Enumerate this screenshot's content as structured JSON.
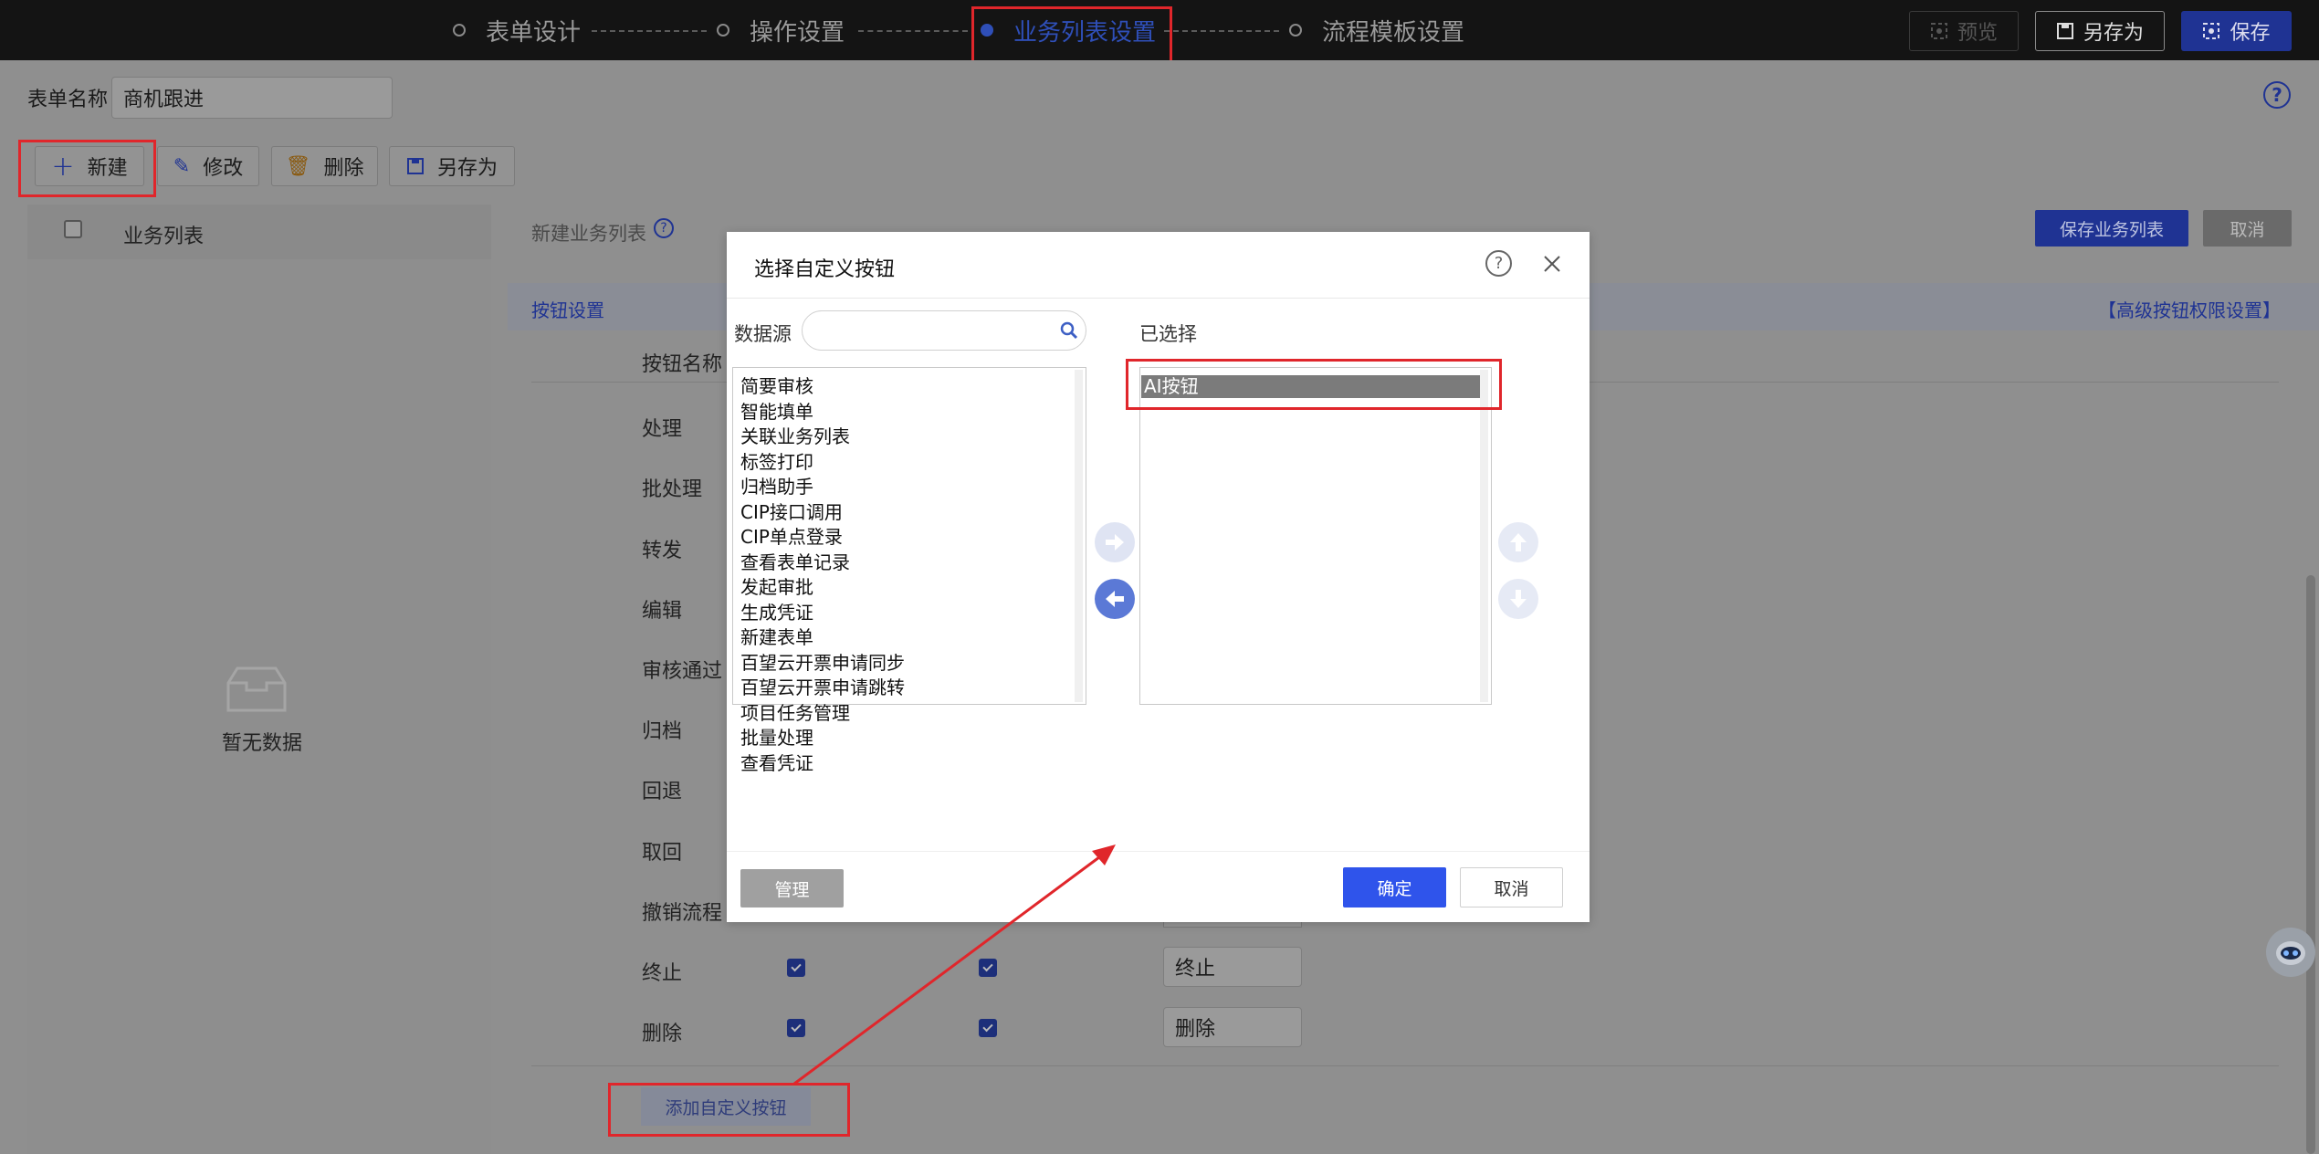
{
  "topbar": {
    "steps": [
      {
        "label": "表单设计"
      },
      {
        "label": "操作设置"
      },
      {
        "label": "业务列表设置"
      },
      {
        "label": "流程模板设置"
      }
    ],
    "preview_label": "预览",
    "save_as_label": "另存为",
    "save_label": "保存"
  },
  "form": {
    "name_label": "表单名称",
    "name_value": "商机跟进"
  },
  "toolbar": {
    "new_label": "新建",
    "edit_label": "修改",
    "delete_label": "删除",
    "save_as_label": "另存为"
  },
  "left_panel": {
    "header": "业务列表",
    "empty_text": "暂无数据"
  },
  "right_panel": {
    "title": "新建业务列表",
    "save_list_label": "保存业务列表",
    "cancel_label": "取消",
    "section_title": "按钮设置",
    "advanced_link": "【高级按钮权限设置】",
    "column_header": "按钮名称",
    "rows": [
      "处理",
      "批处理",
      "转发",
      "编辑",
      "审核通过",
      "归档",
      "回退",
      "取回",
      "撤销流程",
      "终止",
      "删除"
    ],
    "row_inputs": {
      "terminate": "终止",
      "delete": "删除"
    },
    "add_custom_label": "添加自定义按钮"
  },
  "dialog": {
    "title": "选择自定义按钮",
    "source_label": "数据源",
    "search_placeholder": "",
    "selected_label": "已选择",
    "source_items": [
      "简要审核",
      "智能填单",
      "关联业务列表",
      "标签打印",
      "归档助手",
      "CIP接口调用",
      "CIP单点登录",
      "查看表单记录",
      "发起审批",
      "生成凭证",
      "新建表单",
      "百望云开票申请同步",
      "百望云开票申请跳转",
      "项目任务管理",
      "批量处理",
      "查看凭证"
    ],
    "selected_items": [
      "AI按钮"
    ],
    "manage_label": "管理",
    "confirm_label": "确定",
    "cancel_label": "取消"
  },
  "colors": {
    "accent": "#2f54eb",
    "dim_accent": "#1f3393",
    "highlight": "#e0262b"
  }
}
